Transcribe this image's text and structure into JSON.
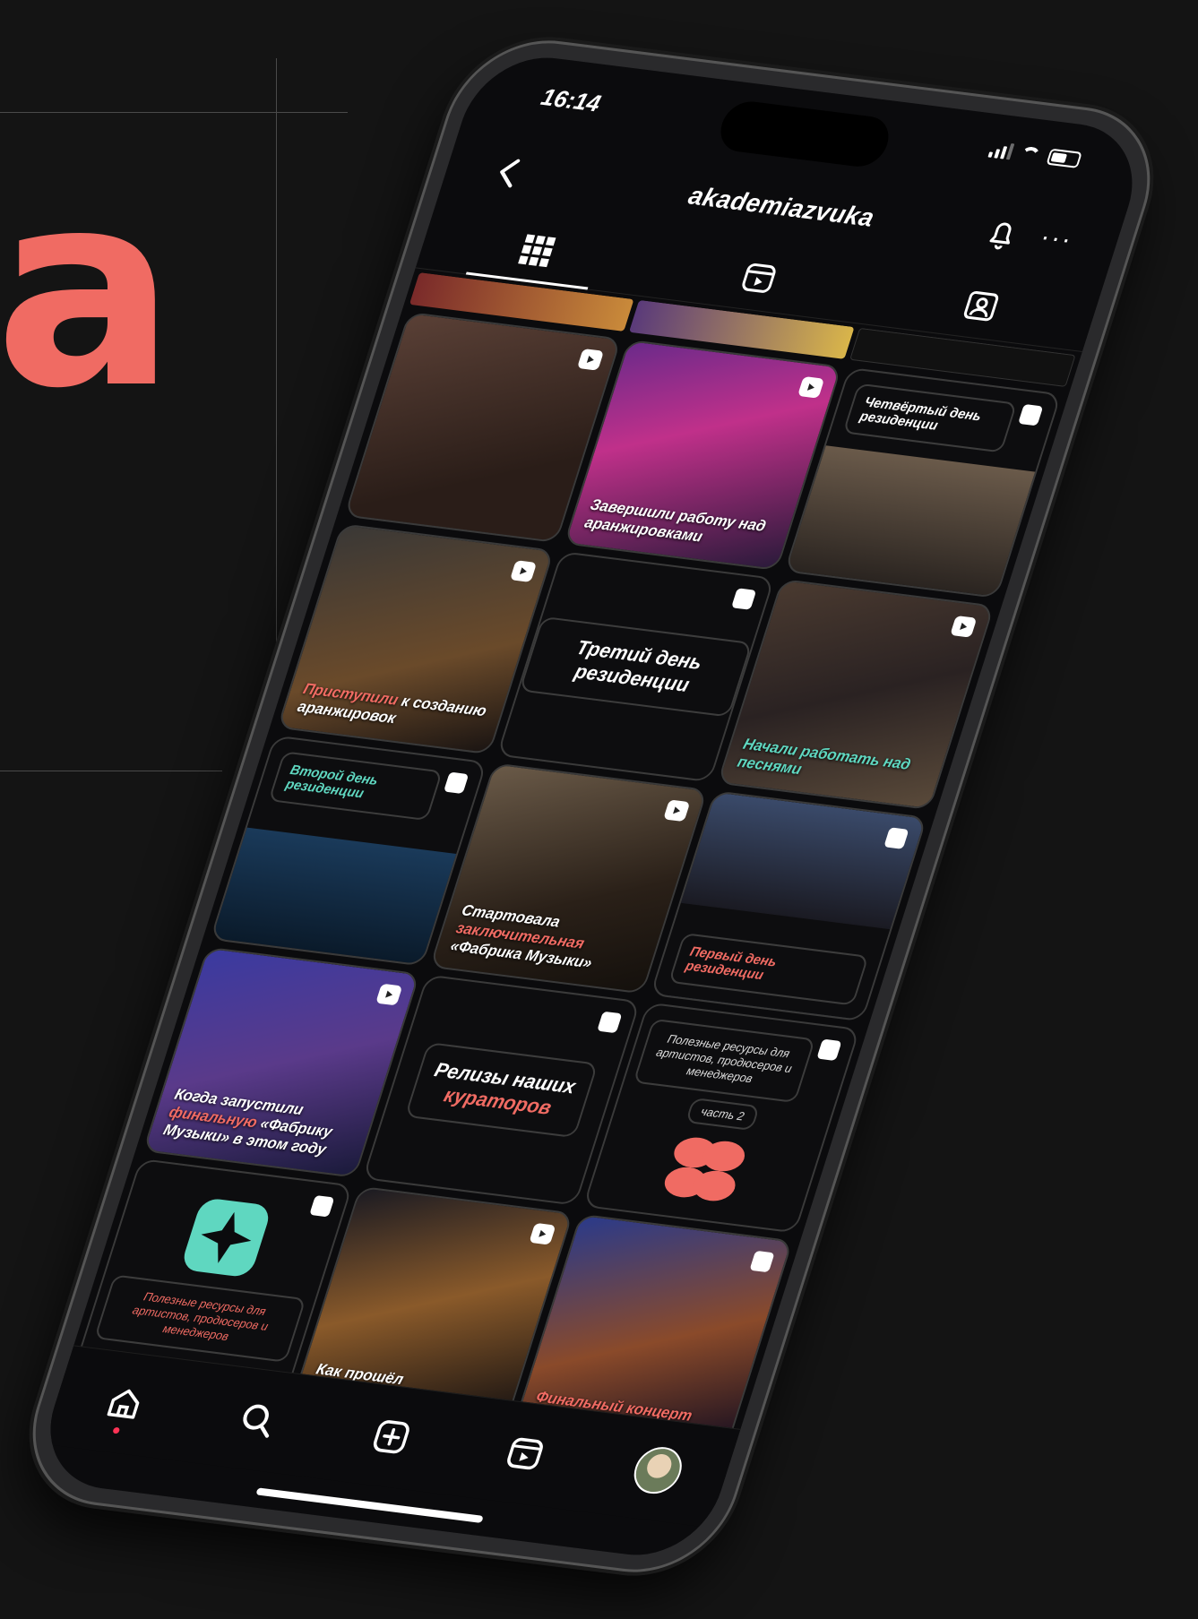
{
  "hero": {
    "letter": "а",
    "color": "#f06b63"
  },
  "status": {
    "time": "16:14"
  },
  "header": {
    "username": "akademiazvuka",
    "more": "···"
  },
  "tabs": [
    {
      "icon": "grid-icon",
      "active": true
    },
    {
      "icon": "reels-icon",
      "active": false
    },
    {
      "icon": "tagged-icon",
      "active": false
    }
  ],
  "posts": [
    {
      "caption_main": "",
      "kind": "photo"
    },
    {
      "caption_main": "Завершили работу над аранжировками",
      "kind": "photo"
    },
    {
      "caption_main": "Четвёртый день резиденции",
      "kind": "photo"
    },
    {
      "caption_main": "Приступили",
      "caption_rest": "к созданию аранжировок",
      "kind": "photo"
    },
    {
      "caption_main": "Третий день резиденции",
      "kind": "label"
    },
    {
      "caption_main": "Начали работать над песнями",
      "kind": "photo"
    },
    {
      "caption_main": "Второй день резиденции",
      "kind": "label"
    },
    {
      "caption_main": "Стартовала",
      "caption_accent": "заключительная",
      "caption_rest": "«Фабрика Музыки»",
      "kind": "photo"
    },
    {
      "caption_main": "Первый день резиденции",
      "kind": "label"
    },
    {
      "caption_main": "Когда запустили",
      "caption_accent": "финальную",
      "caption_rest": "«Фабрику Музыки» в этом году",
      "kind": "photo"
    },
    {
      "caption_main": "Релизы наших",
      "caption_accent": "кураторов",
      "kind": "label"
    },
    {
      "caption_main": "Полезные ресурсы для артистов, продюсеров и менеджеров",
      "sub": "часть 2",
      "kind": "logo"
    },
    {
      "caption_main": "Полезные ресурсы для артистов, продюсеров и менеджеров",
      "kind": "logo2"
    },
    {
      "caption_main": "Как прошёл",
      "kind": "photo"
    },
    {
      "caption_main": "Финальный концерт",
      "kind": "photo"
    }
  ],
  "colors": {
    "accent": "#f06b63",
    "teal": "#5fd7c0",
    "background": "#141414"
  },
  "nav": [
    {
      "icon": "home-icon"
    },
    {
      "icon": "search-icon"
    },
    {
      "icon": "create-icon"
    },
    {
      "icon": "reels-icon"
    },
    {
      "icon": "profile-avatar"
    }
  ]
}
